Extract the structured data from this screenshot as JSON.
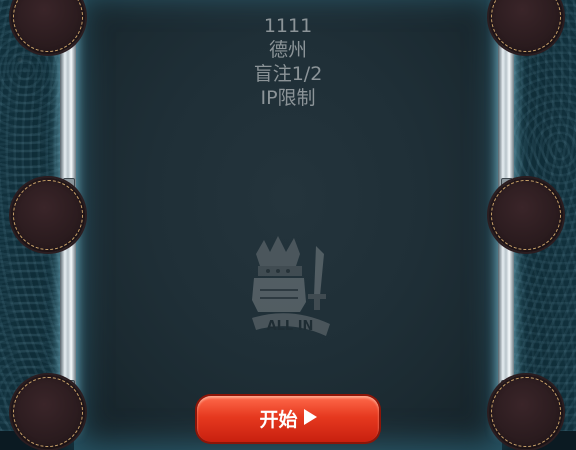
{
  "table_info": {
    "room_id": "1111",
    "game_type": "德州",
    "blinds": "盲注1/2",
    "restriction": "IP限制"
  },
  "logo": {
    "icon": "allin-crown-logo-icon",
    "text": "ALL IN"
  },
  "start_button": {
    "label": "开始",
    "icon": "play-icon"
  },
  "seats": [
    "seat-top-left",
    "seat-mid-left",
    "seat-bottom-left",
    "seat-top-right",
    "seat-mid-right",
    "seat-bottom-right"
  ],
  "colors": {
    "felt": "#1f2f37",
    "rail_glow": "#39849c",
    "seat_border": "#c9a36a",
    "button": "#e6391f"
  }
}
